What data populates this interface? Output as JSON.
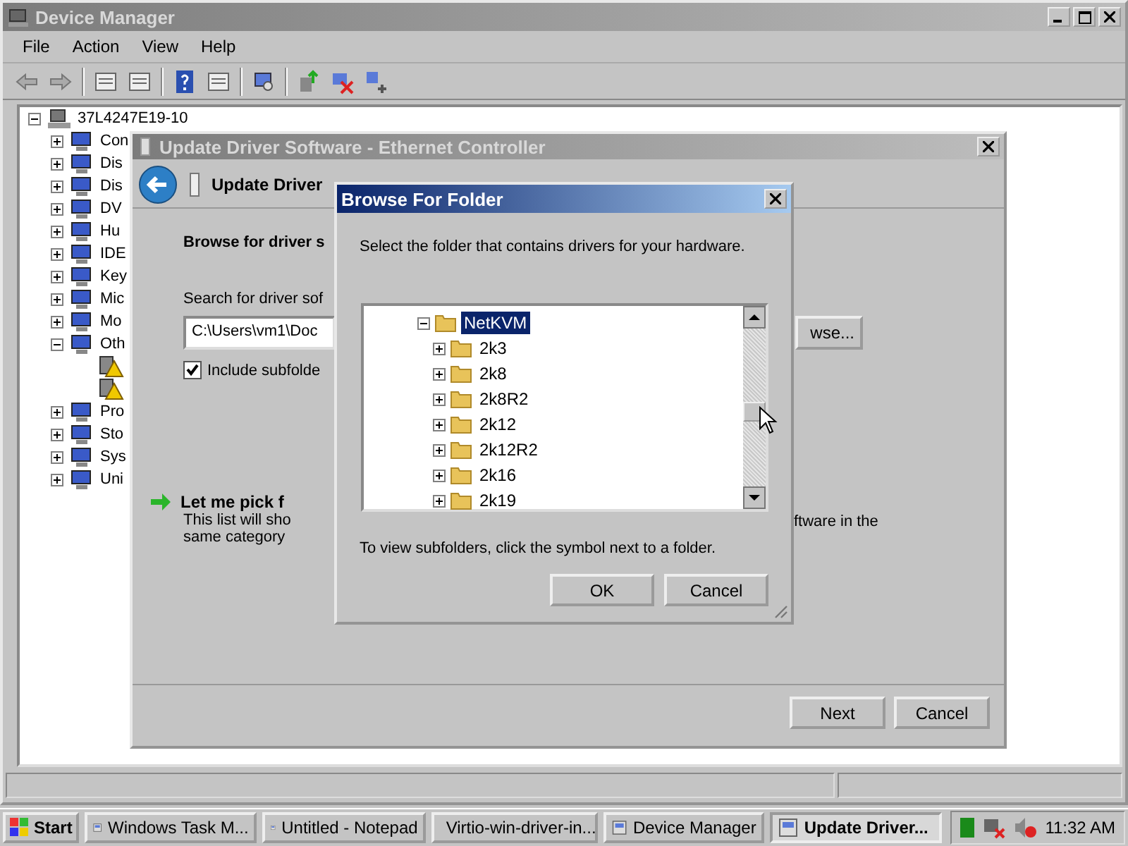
{
  "device_manager": {
    "title": "Device Manager",
    "menu": [
      "File",
      "Action",
      "View",
      "Help"
    ],
    "tree": {
      "label": "37L4247E19-10",
      "expanded": true,
      "children": [
        {
          "label": "Con",
          "expanded": false
        },
        {
          "label": "Dis",
          "expanded": false
        },
        {
          "label": "Dis",
          "expanded": false
        },
        {
          "label": "DV",
          "expanded": false
        },
        {
          "label": "Hu",
          "expanded": false
        },
        {
          "label": "IDE",
          "expanded": false
        },
        {
          "label": "Key",
          "expanded": false
        },
        {
          "label": "Mic",
          "expanded": false
        },
        {
          "label": "Mo",
          "expanded": false
        },
        {
          "label": "Oth",
          "expanded": true,
          "children": [
            {
              "warning": true
            },
            {
              "warning": true
            }
          ]
        },
        {
          "label": "Pro",
          "expanded": false
        },
        {
          "label": "Sto",
          "expanded": false
        },
        {
          "label": "Sys",
          "expanded": false
        },
        {
          "label": "Uni",
          "expanded": false
        }
      ]
    }
  },
  "update_driver": {
    "title": "Update Driver Software - Ethernet Controller",
    "heading": "Update Driver",
    "section_title": "Browse for driver s",
    "search_label": "Search for driver sof",
    "path_field": {
      "value": "C:\\Users\\vm1\\Doc"
    },
    "browse_button": "wse...",
    "include_subfolders": {
      "label": "Include subfolde",
      "checked": true
    },
    "pick_option": {
      "title": "Let me pick f",
      "lines": [
        "This list will sho",
        "same category"
      ],
      "right_text": "ftware in the"
    },
    "buttons": [
      "Next",
      "Cancel"
    ]
  },
  "browse_dialog": {
    "title": "Browse For Folder",
    "instruction": "Select the folder that contains drivers for your hardware.",
    "tree": [
      {
        "label": "NetKVM",
        "expanded": true,
        "selected": true,
        "children": [
          {
            "label": "2k3",
            "expanded": false,
            "selected": false
          },
          {
            "label": "2k8",
            "expanded": false,
            "selected": false
          },
          {
            "label": "2k8R2",
            "expanded": false,
            "selected": false
          },
          {
            "label": "2k12",
            "expanded": false,
            "selected": false
          },
          {
            "label": "2k12R2",
            "expanded": false,
            "selected": false
          },
          {
            "label": "2k16",
            "expanded": false,
            "selected": false
          },
          {
            "label": "2k19",
            "expanded": false,
            "selected": false
          }
        ]
      }
    ],
    "hint": "To view subfolders, click the symbol next to a folder.",
    "buttons": [
      "OK",
      "Cancel"
    ]
  },
  "taskbar": {
    "start": "Start",
    "tasks": [
      {
        "label": "Windows Task M...",
        "selected": false
      },
      {
        "label": "Untitled - Notepad",
        "selected": false
      },
      {
        "label": "Virtio-win-driver-in...",
        "selected": false
      },
      {
        "label": "Device Manager",
        "selected": false
      },
      {
        "label": "Update Driver...",
        "selected": true
      }
    ],
    "clock": "11:32 AM"
  }
}
